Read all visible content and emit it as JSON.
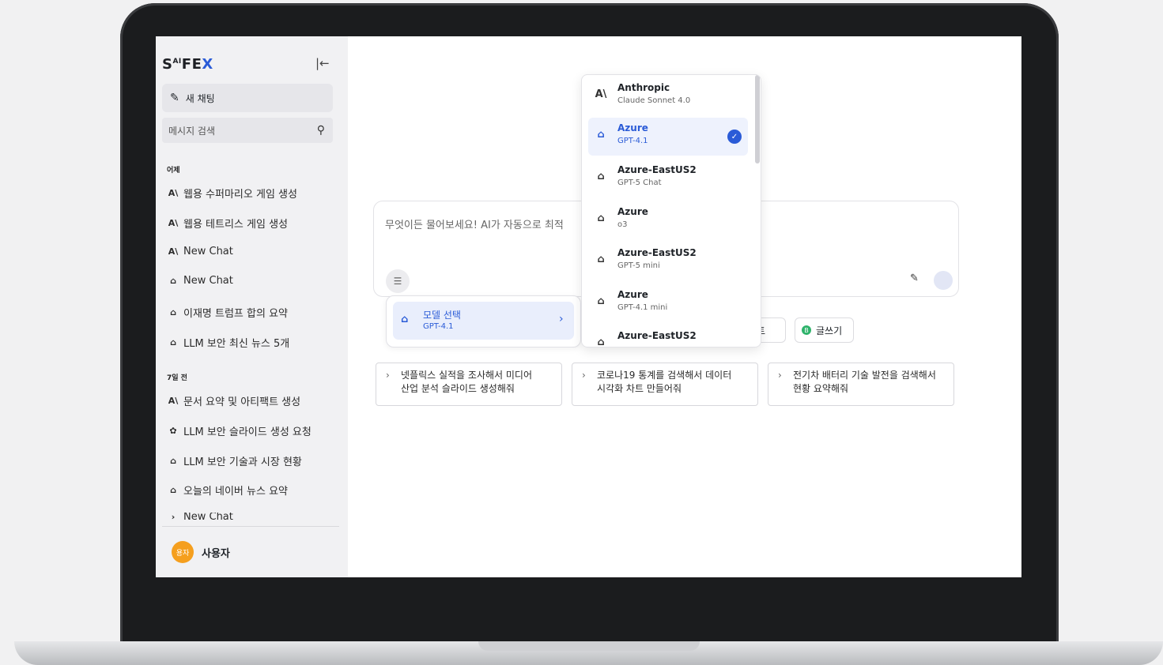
{
  "sidebar": {
    "logo": {
      "main": "S",
      "sup": "AI",
      "rest": "FE",
      "x": "X"
    },
    "collapse_icon": "|←",
    "new_chat_label": "새 채팅",
    "search_placeholder": "메시지 검색",
    "sections": [
      {
        "label": "어제",
        "items": [
          {
            "icon": "anthropic-icon",
            "label": "웹용 수퍼마리오 게임 생성"
          },
          {
            "icon": "anthropic-icon",
            "label": "웹용 테트리스 게임 생성"
          },
          {
            "icon": "anthropic-icon",
            "label": "New Chat"
          },
          {
            "icon": "bot-icon",
            "label": "New Chat"
          },
          {
            "icon": "bot-icon",
            "label": "이재명 트럼프 합의 요약"
          },
          {
            "icon": "bot-icon",
            "label": "LLM 보안 최신 뉴스 5개"
          }
        ]
      },
      {
        "label": "7일 전",
        "items": [
          {
            "icon": "anthropic-icon",
            "label": "문서 요약 및 아티팩트 생성"
          },
          {
            "icon": "openai-icon",
            "label": "LLM 보안 슬라이드 생성 요청"
          },
          {
            "icon": "bot-icon",
            "label": "LLM 보안 기술과 시장 현황"
          },
          {
            "icon": "bot-icon",
            "label": "오늘의 네이버 뉴스 요약"
          },
          {
            "icon": "chevron-right-icon",
            "label": "New Chat"
          }
        ]
      }
    ],
    "user": {
      "avatar": "용자",
      "name": "사용자"
    }
  },
  "composer": {
    "placeholder": "무엇이든 물어보세요! AI가 자동으로 최적"
  },
  "model_selector": {
    "title": "모델 선택",
    "selected": "GPT-4.1"
  },
  "chips": [
    {
      "label": "팩트"
    },
    {
      "label": "글쓰기",
      "icon_letter": "B"
    }
  ],
  "suggestions": [
    {
      "line1": "넷플릭스 실적을 조사해서 미디어",
      "line2": "산업 분석 슬라이드 생성해줘"
    },
    {
      "line1": "코로나19 통계를 검색해서 데이터",
      "line2": "시각화 차트 만들어줘"
    },
    {
      "line1": "전기차 배터리 기술 발전을 검색해서",
      "line2": "현황 요약해줘"
    }
  ],
  "model_dropdown": [
    {
      "provider": "Anthropic",
      "model": "Claude Sonnet 4.0",
      "icon": "anthropic-icon",
      "selected": false
    },
    {
      "provider": "Azure",
      "model": "GPT-4.1",
      "icon": "bot-icon",
      "selected": true
    },
    {
      "provider": "Azure-EastUS2",
      "model": "GPT-5 Chat",
      "icon": "bot-icon",
      "selected": false
    },
    {
      "provider": "Azure",
      "model": "o3",
      "icon": "bot-icon",
      "selected": false
    },
    {
      "provider": "Azure-EastUS2",
      "model": "GPT-5 mini",
      "icon": "bot-icon",
      "selected": false
    },
    {
      "provider": "Azure",
      "model": "GPT-4.1 mini",
      "icon": "bot-icon",
      "selected": false
    },
    {
      "provider": "Azure-EastUS2",
      "model": "",
      "icon": "bot-icon",
      "selected": false
    }
  ],
  "colors": {
    "accent": "#2a5bd7",
    "avatar": "#f59f1e",
    "chip_icon": "#2fb36b"
  }
}
